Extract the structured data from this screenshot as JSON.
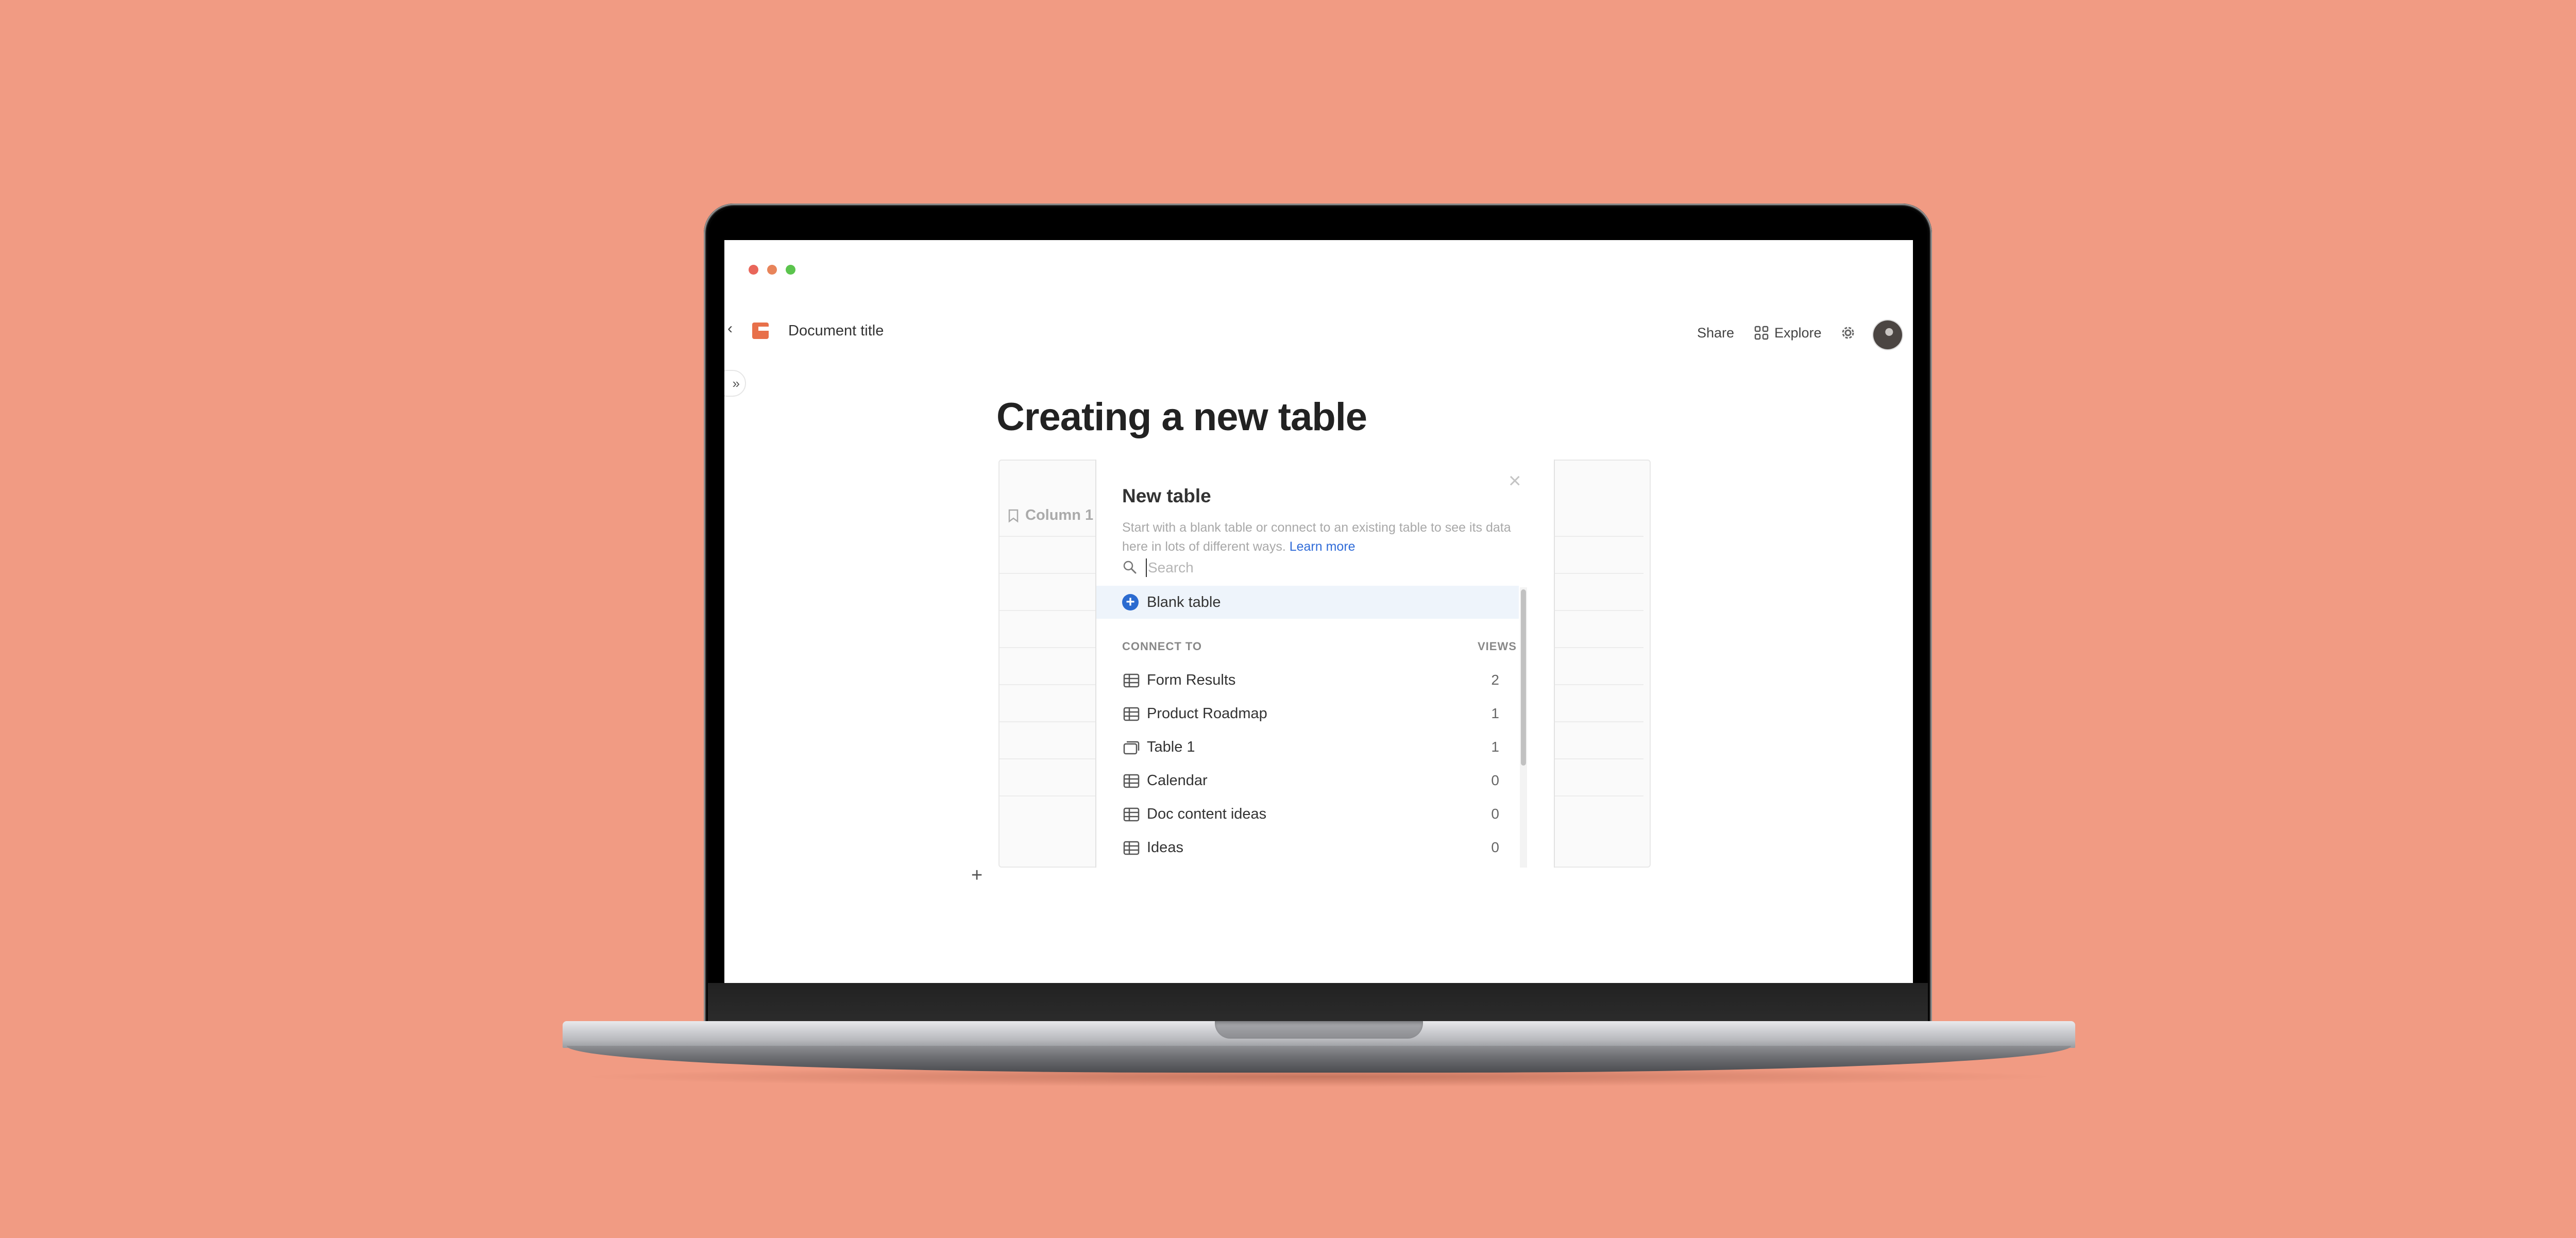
{
  "window": {
    "traffic_lights": [
      "close",
      "minimize",
      "maximize"
    ]
  },
  "header": {
    "doc_title": "Document title",
    "share_label": "Share",
    "explore_label": "Explore"
  },
  "page": {
    "title": "Creating a new table"
  },
  "background_table": {
    "column_header": "Column 1"
  },
  "dialog": {
    "title": "New table",
    "description": "Start with a blank table or connect to an existing table to see its data here in lots of different ways.",
    "learn_more": "Learn more",
    "search_placeholder": "Search",
    "blank_table_label": "Blank table",
    "section_left": "CONNECT TO",
    "section_right": "VIEWS",
    "items": [
      {
        "label": "Form Results",
        "count": "2",
        "icon": "table-icon"
      },
      {
        "label": "Product Roadmap",
        "count": "1",
        "icon": "table-icon"
      },
      {
        "label": "Table 1",
        "count": "1",
        "icon": "view-icon"
      },
      {
        "label": "Calendar",
        "count": "0",
        "icon": "table-icon"
      },
      {
        "label": "Doc content ideas",
        "count": "0",
        "icon": "table-icon"
      },
      {
        "label": "Ideas",
        "count": "0",
        "icon": "table-icon"
      }
    ]
  },
  "colors": {
    "background": "#f19b83",
    "accent_blue": "#2b6bd0",
    "link_blue": "#2f6bd8",
    "doc_icon_orange": "#e8704a"
  }
}
